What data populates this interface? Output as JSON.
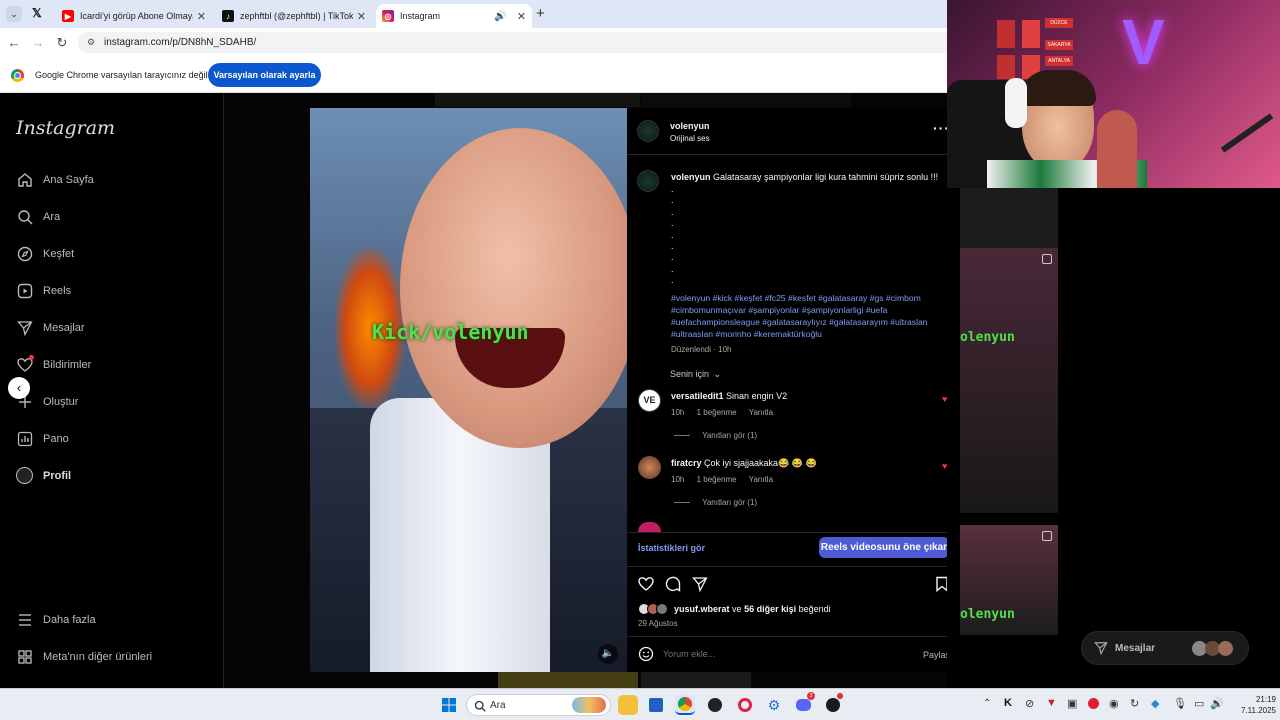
{
  "browser": {
    "tabs": [
      {
        "title": "Icardi'yi görüp Abone Olmayan",
        "active": false
      },
      {
        "title": "zephftbl (@zephftbl) | TikTok",
        "active": false
      },
      {
        "title": "Instagram",
        "active": true
      }
    ],
    "url": "instagram.com/p/DN8hN_SDAHB/",
    "infobar_text": "Google Chrome varsayılan tarayıcınız değil",
    "infobar_button": "Varsayılan olarak ayarla"
  },
  "sidebar": {
    "logo": "Instagram",
    "items": [
      {
        "label": "Ana Sayfa",
        "icon": "home-icon"
      },
      {
        "label": "Ara",
        "icon": "search-icon"
      },
      {
        "label": "Keşfet",
        "icon": "compass-icon"
      },
      {
        "label": "Reels",
        "icon": "reels-icon"
      },
      {
        "label": "Mesajlar",
        "icon": "send-icon"
      },
      {
        "label": "Bildirimler",
        "icon": "heart-icon"
      },
      {
        "label": "Oluştur",
        "icon": "plus-icon"
      },
      {
        "label": "Pano",
        "icon": "chart-icon"
      },
      {
        "label": "Profil",
        "icon": "avatar-icon"
      }
    ],
    "more": "Daha fazla",
    "meta_products": "Meta'nın diğer ürünleri"
  },
  "video": {
    "overlay_text": "Kick/volenyun"
  },
  "post": {
    "username": "volenyun",
    "audio": "Orijinal ses",
    "caption_user": "volenyun",
    "caption_text": "Galatasaray şampiyonlar ligi kura tahmini süpriz sonlu !!!",
    "caption_dots": [
      ".",
      ".",
      ".",
      ".",
      ".",
      ".",
      ".",
      ".",
      "."
    ],
    "hashtags": "#volenyun #kick #keşfet #fc25 #kesfet #galatasaray #gs #cimbom #cimbomunmaçıvar #şampiyonlar #şampiyonlarligi #uefa #uefachampionsleague #galatasaraylıyız #galatasarayım #ultraslan #ultraaslan #morinho #keremaktürkoğlu",
    "edited": "Düzenlendi · 10h",
    "sort": "Senin için",
    "comments": [
      {
        "user": "versatiledit1",
        "text": "Sinan engin V2",
        "time": "10h",
        "likes": "1 beğenme",
        "reply": "Yanıtla",
        "view_replies": "Yanıtları gör (1)"
      },
      {
        "user": "firatcry",
        "text": "Çok iyi sjajjaakaka😂 😂 😂",
        "time": "10h",
        "likes": "1 beğenme",
        "reply": "Yanıtla",
        "view_replies": "Yanıtları gör (1)"
      }
    ],
    "insights": "İstatistikleri gör",
    "boost": "Reels videosunu öne çıkar",
    "liked_by_user": "yusuf.wberat",
    "liked_by_mid": "ve",
    "liked_by_others": "56 diğer kişi",
    "liked_by_suffix": "beğendi",
    "date": "29 Ağustos",
    "comment_placeholder": "Yorum ekle...",
    "post_button": "Paylaş"
  },
  "right": {
    "overlay_text_1": "olenyun",
    "overlay_text_2": "olenyun",
    "messages_label": "Mesajlar",
    "posters": [
      "DÜZCE",
      "SAKARYA",
      "ANTALYA"
    ]
  },
  "taskbar": {
    "search": "Ara",
    "time": "21:19",
    "date": "7.11.2025"
  },
  "colors": {
    "ig_blue": "#4f5bd5",
    "link": "#7f9cf5",
    "heart_red": "#ff3040",
    "chrome_blue": "#0b57d0"
  }
}
